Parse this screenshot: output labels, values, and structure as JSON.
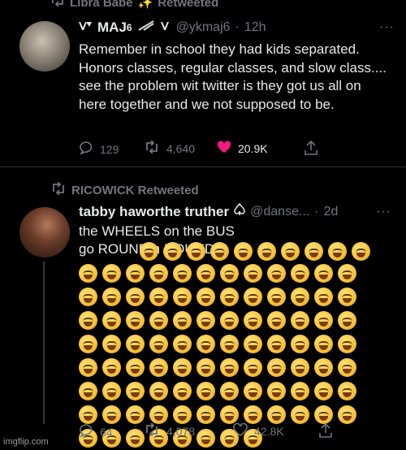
{
  "top_banner": {
    "label": "Libra Babe",
    "sparkle": "✨",
    "suffix": "Retweeted"
  },
  "tweet1": {
    "name": "MAJ",
    "name_suffix": "6",
    "handle": "@ykmaj6",
    "dot": "·",
    "time": "12h",
    "more": "···",
    "text": "Remember in school they had kids separated. Honors classes, regular classes, and slow class.... see the problem wit twitter is they got us all on here together and we not supposed to be.",
    "replies": "129",
    "retweets": "4,640",
    "likes": "20.9K"
  },
  "retweet_banner2": {
    "label": "RICOWICK Retweeted"
  },
  "tweet2": {
    "name": "tabby haworthe truther",
    "handle": "@danse...",
    "dot": "·",
    "time": "2d",
    "more": "···",
    "text": "the WHEELS on the BUS go ROUND n ROUND",
    "emoji_count": 102,
    "replies": "64",
    "retweets": "4,078",
    "likes": "42.8K"
  },
  "watermark": "imgflip.com",
  "colors": {
    "like_active": "#f91880",
    "muted": "#71767b",
    "text": "#e7e9ea",
    "background": "#000000"
  }
}
